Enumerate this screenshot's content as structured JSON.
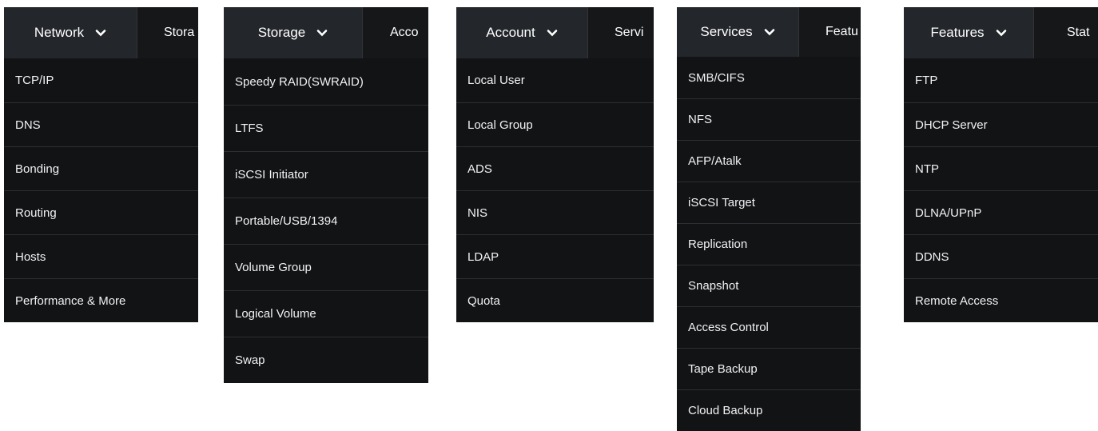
{
  "colors": {
    "panel_bg": "#111315",
    "tab_active_bg": "#23262a",
    "text": "#f2f2f2"
  },
  "icons": {
    "dropdown": "chevron-down-icon"
  },
  "panels": [
    {
      "active_tab": "Network",
      "next_tab": "Stora",
      "items": [
        "TCP/IP",
        "DNS",
        "Bonding",
        "Routing",
        "Hosts",
        "Performance & More"
      ]
    },
    {
      "active_tab": "Storage",
      "next_tab": "Acco",
      "items": [
        "Speedy RAID(SWRAID)",
        "LTFS",
        "iSCSI Initiator",
        "Portable/USB/1394",
        "Volume Group",
        "Logical Volume",
        "Swap"
      ]
    },
    {
      "active_tab": "Account",
      "next_tab": "Servi",
      "items": [
        "Local User",
        "Local Group",
        "ADS",
        "NIS",
        "LDAP",
        "Quota"
      ]
    },
    {
      "active_tab": "Services",
      "next_tab": "Featu",
      "items": [
        "SMB/CIFS",
        "NFS",
        "AFP/Atalk",
        "iSCSI Target",
        "Replication",
        "Snapshot",
        "Access Control",
        "Tape Backup",
        "Cloud Backup"
      ]
    },
    {
      "active_tab": "Features",
      "next_tab": "Stat",
      "items": [
        "FTP",
        "DHCP Server",
        "NTP",
        "DLNA/UPnP",
        "DDNS",
        "Remote Access"
      ]
    }
  ]
}
